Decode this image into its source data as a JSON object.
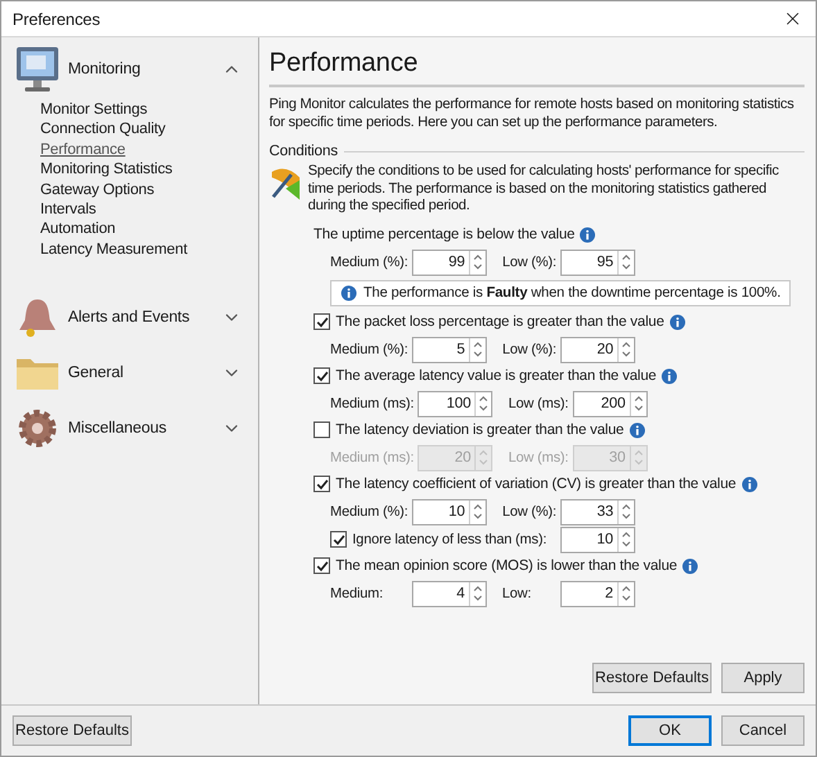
{
  "window": {
    "title": "Preferences"
  },
  "sidebar": {
    "groups": [
      {
        "label": "Monitoring",
        "expanded": true,
        "items": [
          {
            "label": "Monitor Settings",
            "selected": false
          },
          {
            "label": "Connection Quality",
            "selected": false
          },
          {
            "label": "Performance",
            "selected": true
          },
          {
            "label": "Monitoring Statistics",
            "selected": false
          },
          {
            "label": "Gateway Options",
            "selected": false
          },
          {
            "label": "Intervals",
            "selected": false
          },
          {
            "label": "Automation",
            "selected": false
          },
          {
            "label": "Latency Measurement",
            "selected": false
          }
        ]
      },
      {
        "label": "Alerts and Events",
        "expanded": false
      },
      {
        "label": "General",
        "expanded": false
      },
      {
        "label": "Miscellaneous",
        "expanded": false
      }
    ]
  },
  "page": {
    "title": "Performance",
    "description": "Ping Monitor calculates the performance for remote hosts based on monitoring statistics for specific time periods. Here you can set up the performance parameters.",
    "section": "Conditions",
    "intro": "Specify the conditions to be used for calculating hosts' performance for specific time periods. The performance is based on the monitoring statistics gathered during the specified period.",
    "conditions": [
      {
        "kind": "plain",
        "label": "The uptime percentage is below the value",
        "rows": [
          {
            "kind": "pair",
            "fields": [
              {
                "label": "Medium (%):",
                "value": "99"
              },
              {
                "label": "Low (%):",
                "value": "95"
              }
            ]
          }
        ],
        "note": "The performance is **Faulty** when the downtime percentage is 100%."
      },
      {
        "kind": "checkbox",
        "checked": true,
        "label": "The packet loss percentage is greater than the value",
        "rows": [
          {
            "kind": "pair",
            "fields": [
              {
                "label": "Medium (%):",
                "value": "5"
              },
              {
                "label": "Low (%):",
                "value": "20"
              }
            ]
          }
        ]
      },
      {
        "kind": "checkbox",
        "checked": true,
        "label": "The average latency value is greater than the value",
        "rows": [
          {
            "kind": "pair",
            "fields": [
              {
                "label": "Medium (ms):",
                "value": "100"
              },
              {
                "label": "Low (ms):",
                "value": "200"
              }
            ]
          }
        ]
      },
      {
        "kind": "checkbox",
        "checked": false,
        "label": "The latency deviation is greater than the value",
        "rows": [
          {
            "kind": "pair",
            "fields": [
              {
                "label": "Medium (ms):",
                "value": "20"
              },
              {
                "label": "Low (ms):",
                "value": "30"
              }
            ]
          }
        ]
      },
      {
        "kind": "checkbox",
        "checked": true,
        "label": "The latency coefficient of variation (CV) is greater than the value",
        "rows": [
          {
            "kind": "pair",
            "fields": [
              {
                "label": "Medium (%):",
                "value": "10"
              },
              {
                "label": "Low (%):",
                "value": "33"
              }
            ]
          },
          {
            "kind": "check",
            "checked": true,
            "label": "Ignore latency of less than (ms):",
            "value": "10"
          }
        ]
      },
      {
        "kind": "checkbox",
        "checked": true,
        "label": "The mean opinion score (MOS) is lower than the value",
        "rows": [
          {
            "kind": "pair",
            "fields": [
              {
                "label": "Medium:",
                "value": "4"
              },
              {
                "label": "Low:",
                "value": "2"
              }
            ]
          }
        ]
      }
    ],
    "buttons": {
      "restore_defaults": "Restore Defaults",
      "apply": "Apply"
    }
  },
  "footer": {
    "restore_defaults": "Restore Defaults",
    "ok": "OK",
    "cancel": "Cancel"
  }
}
